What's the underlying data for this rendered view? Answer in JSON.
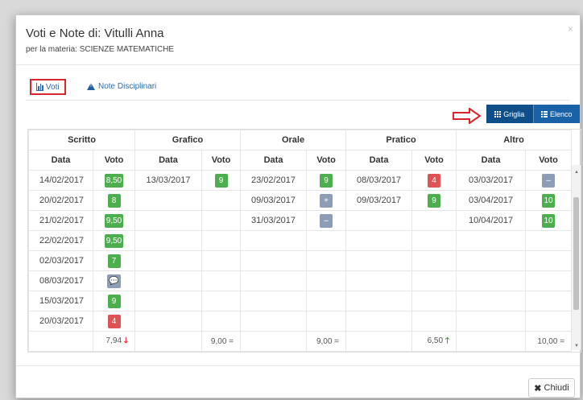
{
  "modal": {
    "title": "Voti e Note di: Vitulli Anna",
    "subtitle": "per la materia: SCIENZE MATEMATICHE",
    "close_glyph": "×"
  },
  "tabs": [
    {
      "label": "Voti",
      "icon": "bar-chart-icon",
      "active": true
    },
    {
      "label": "Note Disciplinari",
      "icon": "warning-icon",
      "active": false
    }
  ],
  "view_toggle": {
    "grid_label": "Griglia",
    "list_label": "Elenco",
    "active": "grid"
  },
  "groups": [
    "Scritto",
    "Grafico",
    "Orale",
    "Pratico",
    "Altro"
  ],
  "subheaders": {
    "date": "Data",
    "grade": "Voto"
  },
  "rows": [
    [
      [
        "14/02/2017",
        "8,50",
        "g"
      ],
      [
        "13/03/2017",
        "9",
        "g"
      ],
      [
        "23/02/2017",
        "9",
        "g"
      ],
      [
        "08/03/2017",
        "4",
        "r"
      ],
      [
        "03/03/2017",
        "–",
        "s"
      ]
    ],
    [
      [
        "20/02/2017",
        "8",
        "g"
      ],
      [
        "",
        ""
      ],
      [
        "09/03/2017",
        "+",
        "s"
      ],
      [
        "09/03/2017",
        "9",
        "g"
      ],
      [
        "03/04/2017",
        "10",
        "g"
      ]
    ],
    [
      [
        "21/02/2017",
        "9,50",
        "g"
      ],
      [
        "",
        ""
      ],
      [
        "31/03/2017",
        "–",
        "s"
      ],
      [
        "",
        ""
      ],
      [
        "10/04/2017",
        "10",
        "g"
      ]
    ],
    [
      [
        "22/02/2017",
        "9,50",
        "g"
      ],
      [
        "",
        ""
      ],
      [
        "",
        ""
      ],
      [
        "",
        ""
      ],
      [
        "",
        ""
      ]
    ],
    [
      [
        "02/03/2017",
        "7",
        "g"
      ],
      [
        "",
        ""
      ],
      [
        "",
        ""
      ],
      [
        "",
        ""
      ],
      [
        "",
        ""
      ]
    ],
    [
      [
        "08/03/2017",
        "💬",
        "s"
      ],
      [
        "",
        ""
      ],
      [
        "",
        ""
      ],
      [
        "",
        ""
      ],
      [
        "",
        ""
      ]
    ],
    [
      [
        "15/03/2017",
        "9",
        "g"
      ],
      [
        "",
        ""
      ],
      [
        "",
        ""
      ],
      [
        "",
        ""
      ],
      [
        "",
        ""
      ]
    ],
    [
      [
        "20/03/2017",
        "4",
        "r"
      ],
      [
        "",
        ""
      ],
      [
        "",
        ""
      ],
      [
        "",
        ""
      ],
      [
        "",
        ""
      ]
    ]
  ],
  "averages": [
    {
      "value": "7,94",
      "trend": "down"
    },
    {
      "value": "9,00 =",
      "trend": "equal"
    },
    {
      "value": "9,00 =",
      "trend": "equal"
    },
    {
      "value": "6,50",
      "trend": "up"
    },
    {
      "value": "10,00 =",
      "trend": "equal"
    }
  ],
  "footer": {
    "close_label": "Chiudi"
  },
  "colors": {
    "green": "#4cae4c",
    "red": "#e05355",
    "slate": "#8c9db5",
    "primary": "#1a62a8",
    "highlight": "#d9262c"
  }
}
